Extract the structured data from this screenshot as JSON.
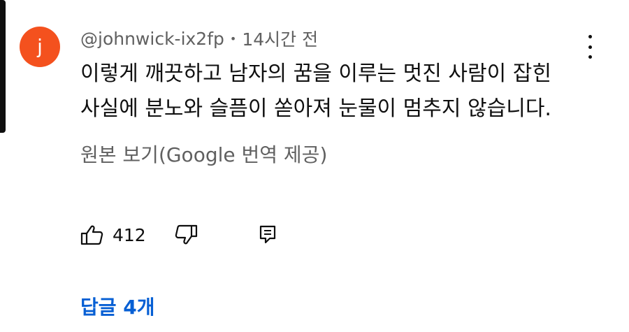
{
  "comment": {
    "avatar_initial": "j",
    "avatar_color": "#f4511e",
    "author": "@johnwick-ix2fp",
    "separator": "•",
    "timestamp": "14시간 전",
    "text_lines": [
      "이렇게 깨끗하고 남자의 꿈을 이루는 멋진 사람이 잡힌",
      "사실에 분노와 슬픔이 쏟아져 눈물이 멈추지 않습니다."
    ],
    "translation_link": "원본 보기(Google 번역 제공)",
    "like_count": "412",
    "replies_label": "답글 4개",
    "replies_color": "#065fd4"
  },
  "icons": {
    "more": "more-vertical-icon",
    "like": "thumbs-up-icon",
    "dislike": "thumbs-down-icon",
    "reply": "reply-icon"
  }
}
